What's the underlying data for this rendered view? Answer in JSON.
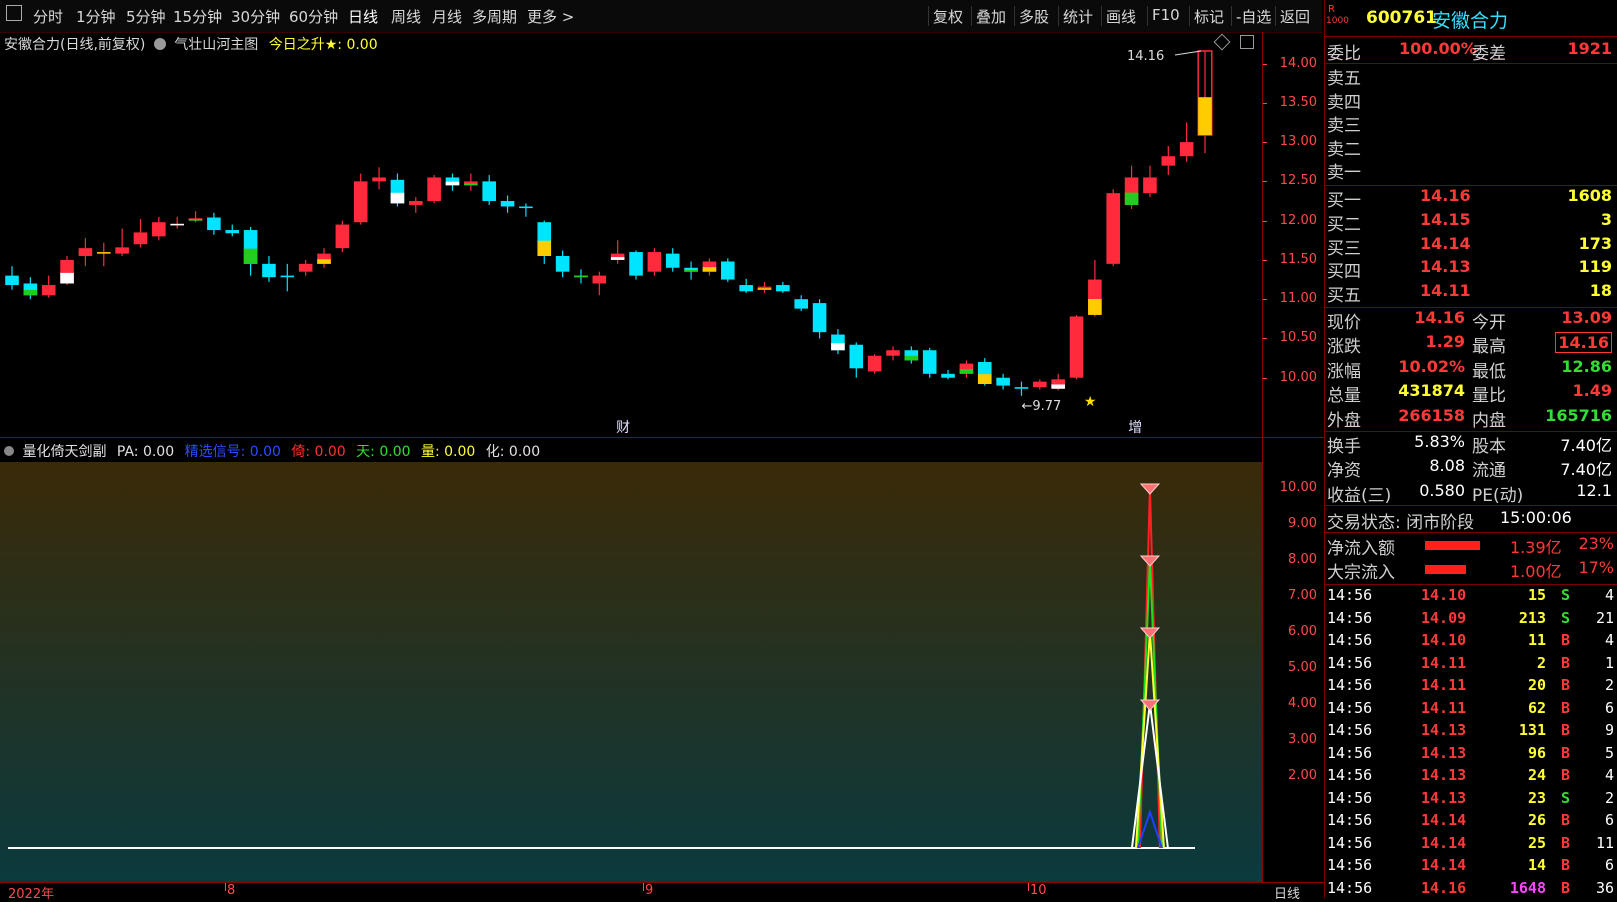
{
  "toolbar": {
    "periods": [
      "分时",
      "1分钟",
      "5分钟",
      "15分钟",
      "30分钟",
      "60分钟",
      "日线",
      "周线",
      "月线",
      "多周期",
      "更多 >"
    ],
    "active_period": "日线",
    "tools": [
      "复权",
      "叠加",
      "多股",
      "统计",
      "画线",
      "F10",
      "标记",
      "-自选",
      "返回"
    ]
  },
  "main_chart": {
    "title": "安徽合力(日线,前复权)",
    "indicator": "气壮山河主图",
    "extra_label": "今日之升★: 0.00",
    "high_marker": "14.16",
    "low_marker": "←9.77",
    "tag_cai": "财",
    "tag_zeng": "增",
    "y_ticks": [
      "14.00",
      "13.50",
      "13.00",
      "12.50",
      "12.00",
      "11.50",
      "11.00",
      "10.50",
      "10.00"
    ]
  },
  "sub_chart": {
    "name": "量化倚天剑副",
    "pa": "PA: 0.00",
    "signal": "精选信号: 0.00",
    "yi": "倚: 0.00",
    "tian": "天: 0.00",
    "liang": "量: 0.00",
    "hua": "化: 0.00",
    "y_ticks": [
      "10.00",
      "9.00",
      "8.00",
      "7.00",
      "6.00",
      "5.00",
      "4.00",
      "3.00",
      "2.00"
    ]
  },
  "x_axis": {
    "labels": [
      "2022年",
      "8",
      "9",
      "10"
    ],
    "period_label": "日线"
  },
  "quote": {
    "code": "600761",
    "name": "安徽合力",
    "badge_r": "R",
    "badge_num": "1000",
    "weibi_label": "委比",
    "weibi": "100.00%",
    "weicha_label": "委差",
    "weicha": "1921",
    "sell": [
      {
        "label": "卖五"
      },
      {
        "label": "卖四"
      },
      {
        "label": "卖三"
      },
      {
        "label": "卖二"
      },
      {
        "label": "卖一"
      }
    ],
    "buy": [
      {
        "label": "买一",
        "price": "14.16",
        "vol": "1608"
      },
      {
        "label": "买二",
        "price": "14.15",
        "vol": "3"
      },
      {
        "label": "买三",
        "price": "14.14",
        "vol": "173"
      },
      {
        "label": "买四",
        "price": "14.13",
        "vol": "119"
      },
      {
        "label": "买五",
        "price": "14.11",
        "vol": "18"
      }
    ],
    "stats": [
      {
        "l1": "现价",
        "v1": "14.16",
        "l2": "今开",
        "v2": "13.09"
      },
      {
        "l1": "涨跌",
        "v1": "1.29",
        "l2": "最高",
        "v2": "14.16"
      },
      {
        "l1": "涨幅",
        "v1": "10.02%",
        "l2": "最低",
        "v2": "12.86"
      },
      {
        "l1": "总量",
        "v1": "431874",
        "l2": "量比",
        "v2": "1.49"
      },
      {
        "l1": "外盘",
        "v1": "266158",
        "l2": "内盘",
        "v2": "165716"
      }
    ],
    "stats2": [
      {
        "l1": "换手",
        "v1": "5.83%",
        "l2": "股本",
        "v2": "7.40亿"
      },
      {
        "l1": "净资",
        "v1": "8.08",
        "l2": "流通",
        "v2": "7.40亿"
      },
      {
        "l1": "收益(三)",
        "v1": "0.580",
        "l2": "PE(动)",
        "v2": "12.1"
      }
    ],
    "status_label": "交易状态: 闭市阶段",
    "status_time": "15:00:06",
    "flow": [
      {
        "label": "净流入额",
        "value": "1.39亿",
        "pct": "23%",
        "ratio": 0.23
      },
      {
        "label": "大宗流入",
        "value": "1.00亿",
        "pct": "17%",
        "ratio": 0.17
      }
    ],
    "trades": [
      {
        "t": "14:56",
        "p": "14.10",
        "v": "15",
        "bs": "S",
        "n": "4"
      },
      {
        "t": "14:56",
        "p": "14.09",
        "v": "213",
        "bs": "S",
        "n": "21"
      },
      {
        "t": "14:56",
        "p": "14.10",
        "v": "11",
        "bs": "B",
        "n": "4"
      },
      {
        "t": "14:56",
        "p": "14.11",
        "v": "2",
        "bs": "B",
        "n": "1"
      },
      {
        "t": "14:56",
        "p": "14.11",
        "v": "20",
        "bs": "B",
        "n": "2"
      },
      {
        "t": "14:56",
        "p": "14.11",
        "v": "62",
        "bs": "B",
        "n": "6"
      },
      {
        "t": "14:56",
        "p": "14.13",
        "v": "131",
        "bs": "B",
        "n": "9"
      },
      {
        "t": "14:56",
        "p": "14.13",
        "v": "96",
        "bs": "B",
        "n": "5"
      },
      {
        "t": "14:56",
        "p": "14.13",
        "v": "24",
        "bs": "B",
        "n": "4"
      },
      {
        "t": "14:56",
        "p": "14.13",
        "v": "23",
        "bs": "S",
        "n": "2"
      },
      {
        "t": "14:56",
        "p": "14.14",
        "v": "26",
        "bs": "B",
        "n": "6"
      },
      {
        "t": "14:56",
        "p": "14.14",
        "v": "25",
        "bs": "B",
        "n": "11"
      },
      {
        "t": "14:56",
        "p": "14.14",
        "v": "14",
        "bs": "B",
        "n": "6"
      },
      {
        "t": "14:56",
        "p": "14.16",
        "v": "1648",
        "bs": "B",
        "n": "36"
      }
    ]
  },
  "chart_data": {
    "type": "candlestick",
    "ylim": [
      9.5,
      14.3
    ],
    "candles": [
      {
        "o": 11.3,
        "c": 11.18,
        "h": 11.42,
        "l": 11.12
      },
      {
        "o": 11.2,
        "c": 11.05,
        "h": 11.28,
        "l": 11.0
      },
      {
        "o": 11.05,
        "c": 11.18,
        "h": 11.3,
        "l": 11.02
      },
      {
        "o": 11.2,
        "c": 11.5,
        "h": 11.55,
        "l": 11.18
      },
      {
        "o": 11.55,
        "c": 11.65,
        "h": 11.78,
        "l": 11.42
      },
      {
        "o": 11.58,
        "c": 11.6,
        "h": 11.72,
        "l": 11.42
      },
      {
        "o": 11.58,
        "c": 11.66,
        "h": 11.9,
        "l": 11.55
      },
      {
        "o": 11.7,
        "c": 11.85,
        "h": 12.02,
        "l": 11.66
      },
      {
        "o": 11.8,
        "c": 11.98,
        "h": 12.05,
        "l": 11.75
      },
      {
        "o": 11.94,
        "c": 11.96,
        "h": 12.05,
        "l": 11.9
      },
      {
        "o": 12.0,
        "c": 12.03,
        "h": 12.12,
        "l": 11.98
      },
      {
        "o": 12.04,
        "c": 11.88,
        "h": 12.1,
        "l": 11.82
      },
      {
        "o": 11.88,
        "c": 11.84,
        "h": 11.95,
        "l": 11.8
      },
      {
        "o": 11.88,
        "c": 11.45,
        "h": 11.92,
        "l": 11.3
      },
      {
        "o": 11.45,
        "c": 11.28,
        "h": 11.55,
        "l": 11.22
      },
      {
        "o": 11.3,
        "c": 11.28,
        "h": 11.45,
        "l": 11.1
      },
      {
        "o": 11.35,
        "c": 11.45,
        "h": 11.5,
        "l": 11.3
      },
      {
        "o": 11.45,
        "c": 11.58,
        "h": 11.65,
        "l": 11.4
      },
      {
        "o": 11.65,
        "c": 11.95,
        "h": 12.0,
        "l": 11.6
      },
      {
        "o": 11.98,
        "c": 12.5,
        "h": 12.6,
        "l": 11.95
      },
      {
        "o": 12.5,
        "c": 12.55,
        "h": 12.68,
        "l": 12.4
      },
      {
        "o": 12.52,
        "c": 12.22,
        "h": 12.6,
        "l": 12.18
      },
      {
        "o": 12.2,
        "c": 12.25,
        "h": 12.3,
        "l": 12.1
      },
      {
        "o": 12.25,
        "c": 12.55,
        "h": 12.58,
        "l": 12.22
      },
      {
        "o": 12.55,
        "c": 12.45,
        "h": 12.6,
        "l": 12.38
      },
      {
        "o": 12.45,
        "c": 12.5,
        "h": 12.6,
        "l": 12.38
      },
      {
        "o": 12.5,
        "c": 12.25,
        "h": 12.58,
        "l": 12.2
      },
      {
        "o": 12.25,
        "c": 12.18,
        "h": 12.32,
        "l": 12.1
      },
      {
        "o": 12.18,
        "c": 12.16,
        "h": 12.22,
        "l": 12.05
      },
      {
        "o": 11.98,
        "c": 11.55,
        "h": 12.0,
        "l": 11.45
      },
      {
        "o": 11.55,
        "c": 11.35,
        "h": 11.62,
        "l": 11.28
      },
      {
        "o": 11.3,
        "c": 11.28,
        "h": 11.38,
        "l": 11.2
      },
      {
        "o": 11.2,
        "c": 11.3,
        "h": 11.35,
        "l": 11.05
      },
      {
        "o": 11.5,
        "c": 11.58,
        "h": 11.75,
        "l": 11.45
      },
      {
        "o": 11.6,
        "c": 11.3,
        "h": 11.62,
        "l": 11.25
      },
      {
        "o": 11.35,
        "c": 11.6,
        "h": 11.65,
        "l": 11.3
      },
      {
        "o": 11.58,
        "c": 11.4,
        "h": 11.65,
        "l": 11.35
      },
      {
        "o": 11.4,
        "c": 11.35,
        "h": 11.48,
        "l": 11.25
      },
      {
        "o": 11.35,
        "c": 11.48,
        "h": 11.52,
        "l": 11.3
      },
      {
        "o": 11.48,
        "c": 11.25,
        "h": 11.52,
        "l": 11.22
      },
      {
        "o": 11.18,
        "c": 11.1,
        "h": 11.26,
        "l": 11.08
      },
      {
        "o": 11.12,
        "c": 11.16,
        "h": 11.22,
        "l": 11.08
      },
      {
        "o": 11.18,
        "c": 11.1,
        "h": 11.22,
        "l": 11.08
      },
      {
        "o": 11.0,
        "c": 10.88,
        "h": 11.05,
        "l": 10.85
      },
      {
        "o": 10.95,
        "c": 10.58,
        "h": 11.0,
        "l": 10.5
      },
      {
        "o": 10.55,
        "c": 10.35,
        "h": 10.62,
        "l": 10.3
      },
      {
        "o": 10.42,
        "c": 10.12,
        "h": 10.45,
        "l": 10.0
      },
      {
        "o": 10.08,
        "c": 10.28,
        "h": 10.3,
        "l": 10.05
      },
      {
        "o": 10.28,
        "c": 10.35,
        "h": 10.4,
        "l": 10.22
      },
      {
        "o": 10.35,
        "c": 10.22,
        "h": 10.4,
        "l": 10.18
      },
      {
        "o": 10.35,
        "c": 10.05,
        "h": 10.38,
        "l": 10.0
      },
      {
        "o": 10.05,
        "c": 10.0,
        "h": 10.1,
        "l": 9.98
      },
      {
        "o": 10.05,
        "c": 10.18,
        "h": 10.22,
        "l": 10.0
      },
      {
        "o": 10.2,
        "c": 9.92,
        "h": 10.25,
        "l": 9.9
      },
      {
        "o": 10.0,
        "c": 9.9,
        "h": 10.05,
        "l": 9.85
      },
      {
        "o": 9.88,
        "c": 9.86,
        "h": 9.95,
        "l": 9.77
      },
      {
        "o": 9.88,
        "c": 9.95,
        "h": 9.98,
        "l": 9.85
      },
      {
        "o": 9.86,
        "c": 9.98,
        "h": 10.05,
        "l": 9.84
      },
      {
        "o": 10.0,
        "c": 10.78,
        "h": 10.8,
        "l": 9.98
      },
      {
        "o": 10.8,
        "c": 11.25,
        "h": 11.5,
        "l": 10.78
      },
      {
        "o": 11.45,
        "c": 12.35,
        "h": 12.4,
        "l": 11.42
      },
      {
        "o": 12.2,
        "c": 12.55,
        "h": 12.7,
        "l": 12.15
      },
      {
        "o": 12.35,
        "c": 12.55,
        "h": 12.7,
        "l": 12.3
      },
      {
        "o": 12.7,
        "c": 12.82,
        "h": 12.95,
        "l": 12.58
      },
      {
        "o": 12.82,
        "c": 13.0,
        "h": 13.25,
        "l": 12.75
      },
      {
        "o": 13.09,
        "c": 14.16,
        "h": 14.16,
        "l": 12.86
      }
    ],
    "fill_styles": "mixed",
    "signal_series": {
      "peak_index": 62,
      "levels": [
        10.0,
        8.0,
        6.0,
        4.0
      ],
      "ylim": [
        0,
        10.5
      ]
    }
  },
  "colors": {
    "up": "#ff2a3c",
    "down": "#00e5ff",
    "grid_border": "#8b0000",
    "sub_top": "#3a2a08",
    "sub_bottom": "#0b3a3e"
  }
}
